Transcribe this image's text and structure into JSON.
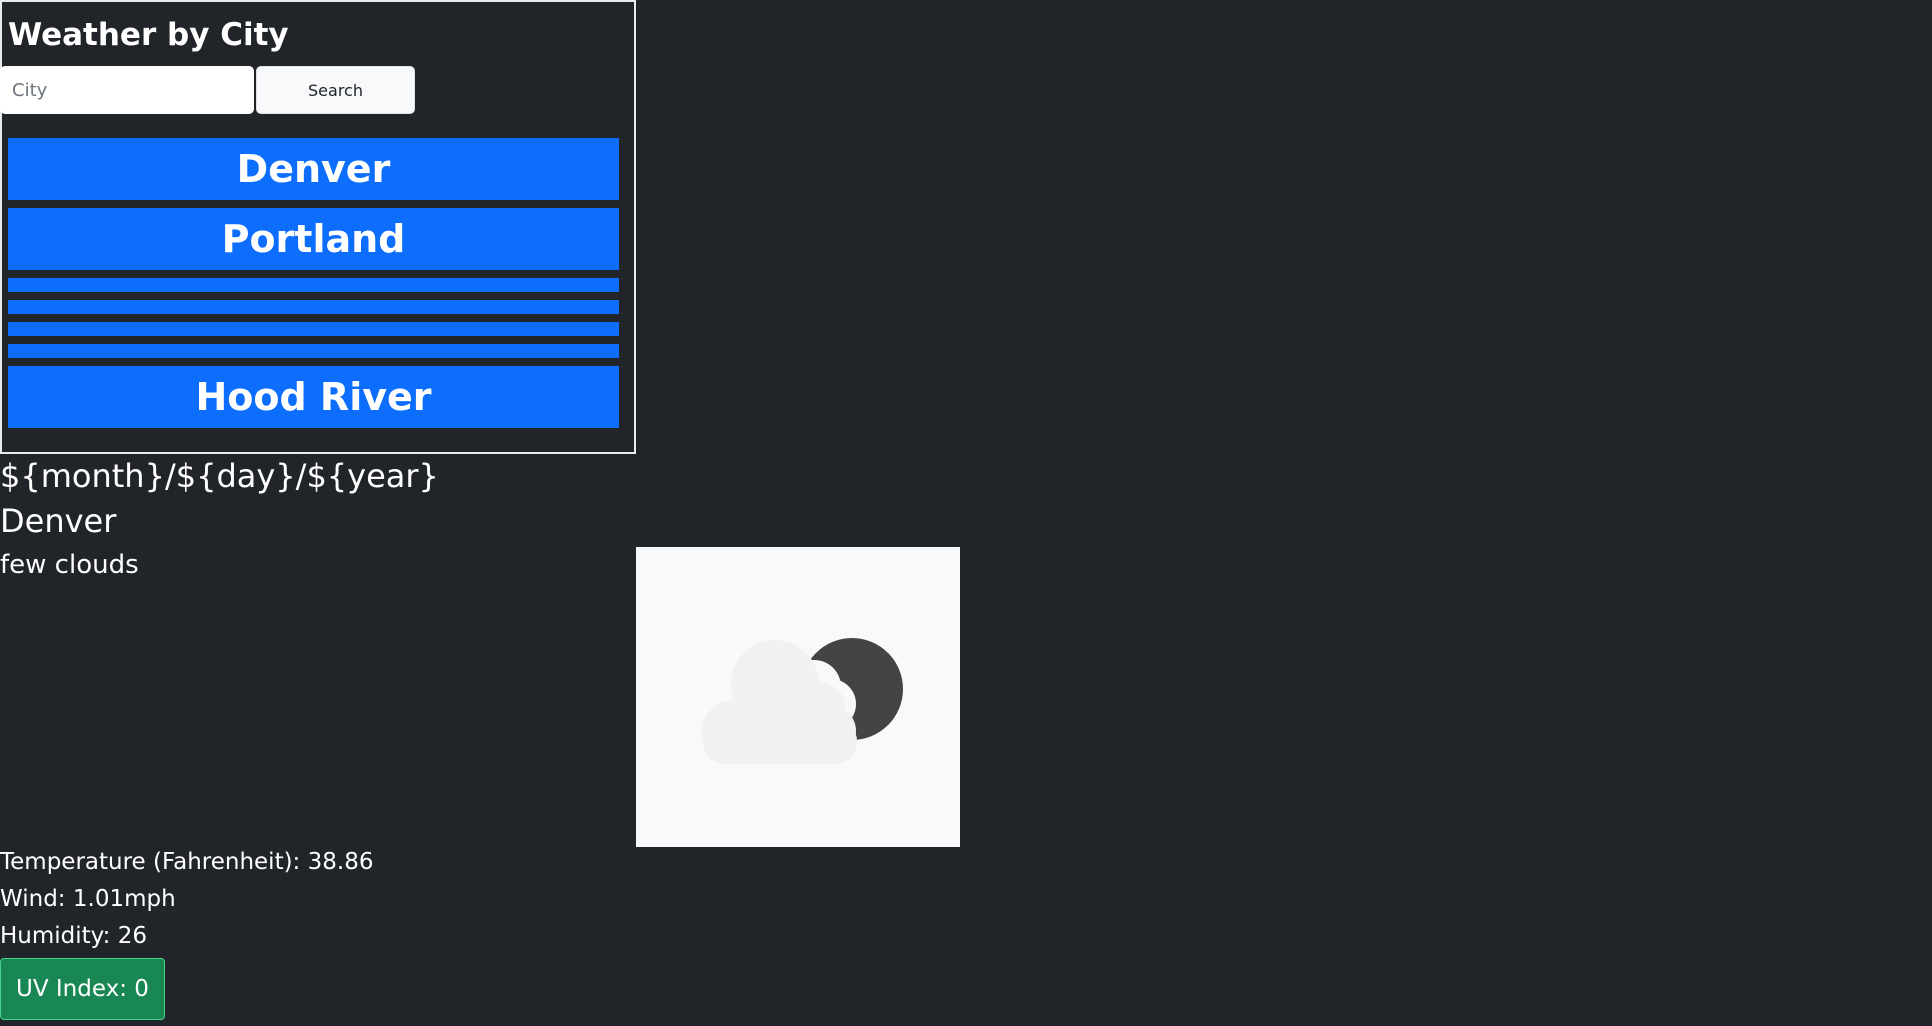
{
  "header": {
    "title": "Weather by City"
  },
  "search": {
    "placeholder": "City",
    "value": "",
    "button_label": "Search"
  },
  "cities": {
    "items": [
      {
        "label": "Denver"
      },
      {
        "label": "Portland"
      },
      {
        "label": ""
      },
      {
        "label": ""
      },
      {
        "label": ""
      },
      {
        "label": ""
      },
      {
        "label": "Hood River"
      }
    ]
  },
  "current": {
    "date": "${month}/${day}/${year}",
    "city": "Denver",
    "description": "few clouds",
    "icon": "few-clouds-night-icon",
    "temperature_label": "Temperature (Fahrenheit): ",
    "temperature_value": "38.86",
    "wind_label": "Wind: ",
    "wind_value": "1.01mph",
    "humidity_label": "Humidity: ",
    "humidity_value": "26",
    "uv_label": "UV Index: ",
    "uv_value": "0"
  },
  "colors": {
    "background": "#212529",
    "city_button": "#0d6efd",
    "uv_low": "#198754",
    "icon_panel": "#f8f9fa"
  }
}
